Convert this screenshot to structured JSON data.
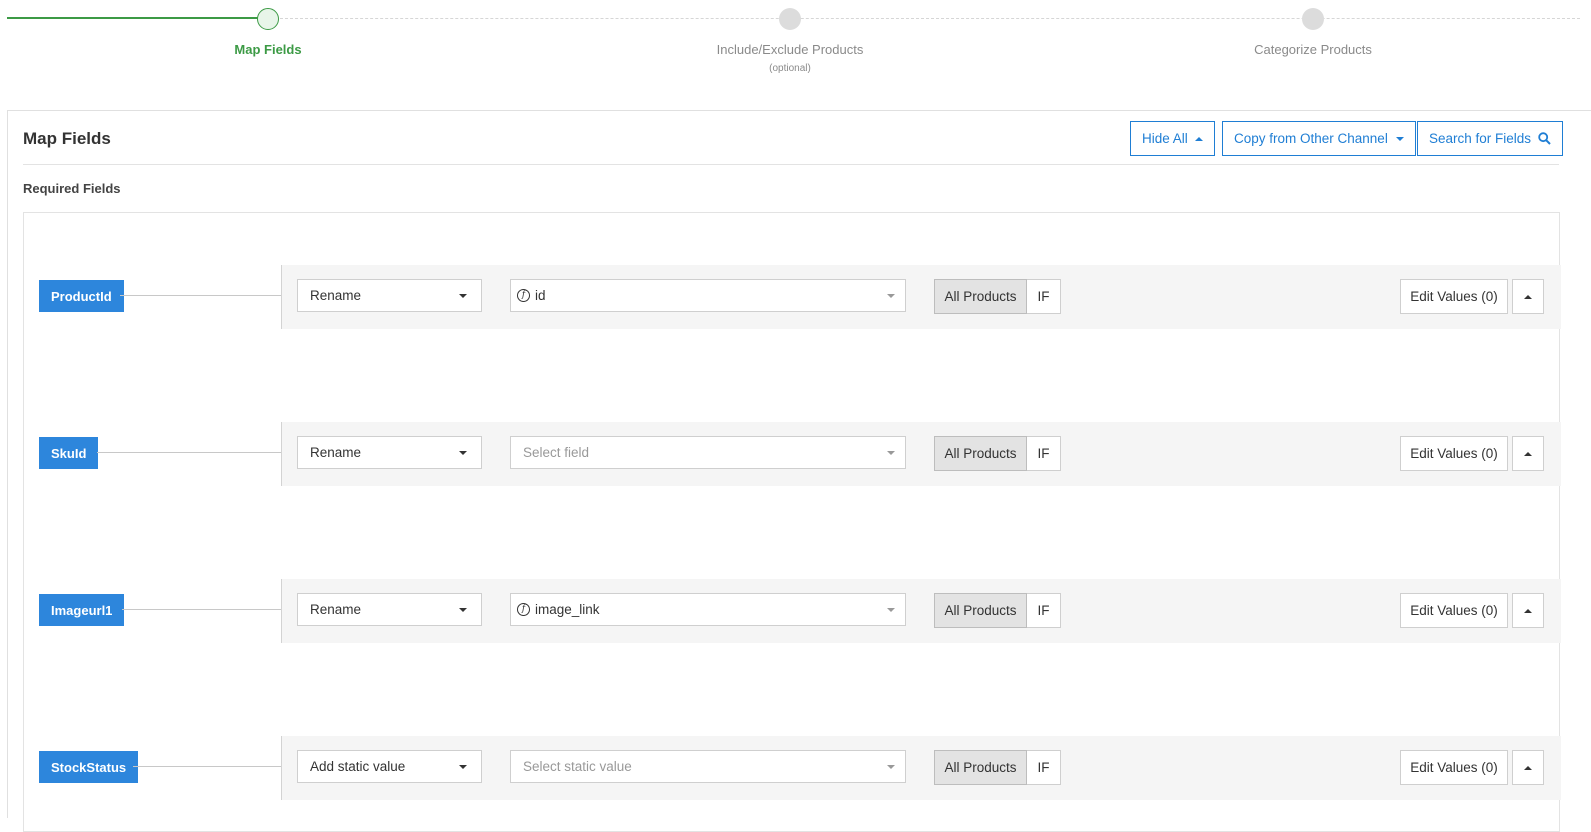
{
  "stepper": {
    "steps": [
      {
        "label": "Map Fields",
        "sub": ""
      },
      {
        "label": "Include/Exclude Products",
        "sub": "(optional)"
      },
      {
        "label": "Categorize Products",
        "sub": ""
      }
    ],
    "active_step": 1,
    "colors": {
      "done": "#3c9a45",
      "pending": "#dcdcdc"
    }
  },
  "panel": {
    "title": "Map Fields",
    "buttons": {
      "hide_all": "Hide All",
      "copy_from": "Copy from Other Channel",
      "search": "Search for Fields"
    },
    "section_title": "Required Fields",
    "accent_color": "#1f7ed4"
  },
  "rows": [
    {
      "name": "ProductId",
      "action": "Rename",
      "field": "id",
      "field_is_function": true,
      "scope": "All Products",
      "condition": "IF",
      "edit": "Edit Values (0)"
    },
    {
      "name": "SkuId",
      "action": "Rename",
      "field": "Select field",
      "field_is_function": false,
      "scope": "All Products",
      "condition": "IF",
      "edit": "Edit Values (0)"
    },
    {
      "name": "Imageurl1",
      "action": "Rename",
      "field": "image_link",
      "field_is_function": true,
      "scope": "All Products",
      "condition": "IF",
      "edit": "Edit Values (0)"
    },
    {
      "name": "StockStatus",
      "action": "Add static value",
      "field": "Select static value",
      "field_is_function": false,
      "scope": "All Products",
      "condition": "IF",
      "edit": "Edit Values (0)"
    }
  ],
  "tag_color": "#2d86dc"
}
